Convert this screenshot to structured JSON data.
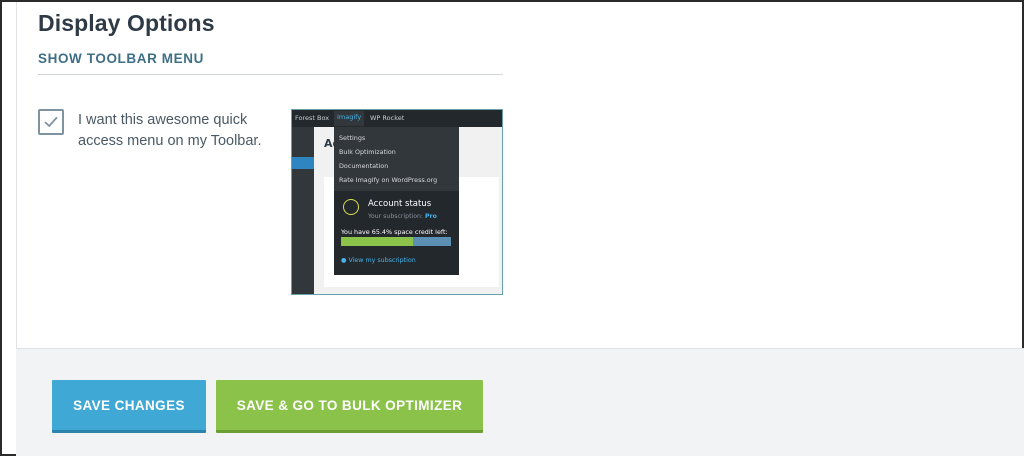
{
  "section": {
    "title": "Display Options",
    "subsection": "SHOW TOOLBAR MENU"
  },
  "toolbar_option": {
    "checked": true,
    "label": "I want this awesome quick access menu on my Toolbar."
  },
  "preview": {
    "adminbar_items": [
      "Forest Box",
      "Imagify",
      "WP Rocket"
    ],
    "content_heading": "Ad",
    "menu_items": [
      "Settings",
      "Bulk Optimization",
      "Documentation",
      "Rate Imagify on WordPress.org"
    ],
    "account_status_title": "Account status",
    "subscription_label": "Your subscription:",
    "subscription_plan": "Pro",
    "space_text": "You have 65.4% space credit left:",
    "space_credit_fraction": 0.654,
    "view_subscription": "View my subscription"
  },
  "buttons": {
    "save": "SAVE CHANGES",
    "save_bulk": "SAVE & GO TO BULK OPTIMIZER"
  },
  "colors": {
    "save_button": "#40a8d4",
    "bulk_button": "#8bc34a",
    "title": "#2e3b47",
    "subsection": "#3f6f86"
  }
}
